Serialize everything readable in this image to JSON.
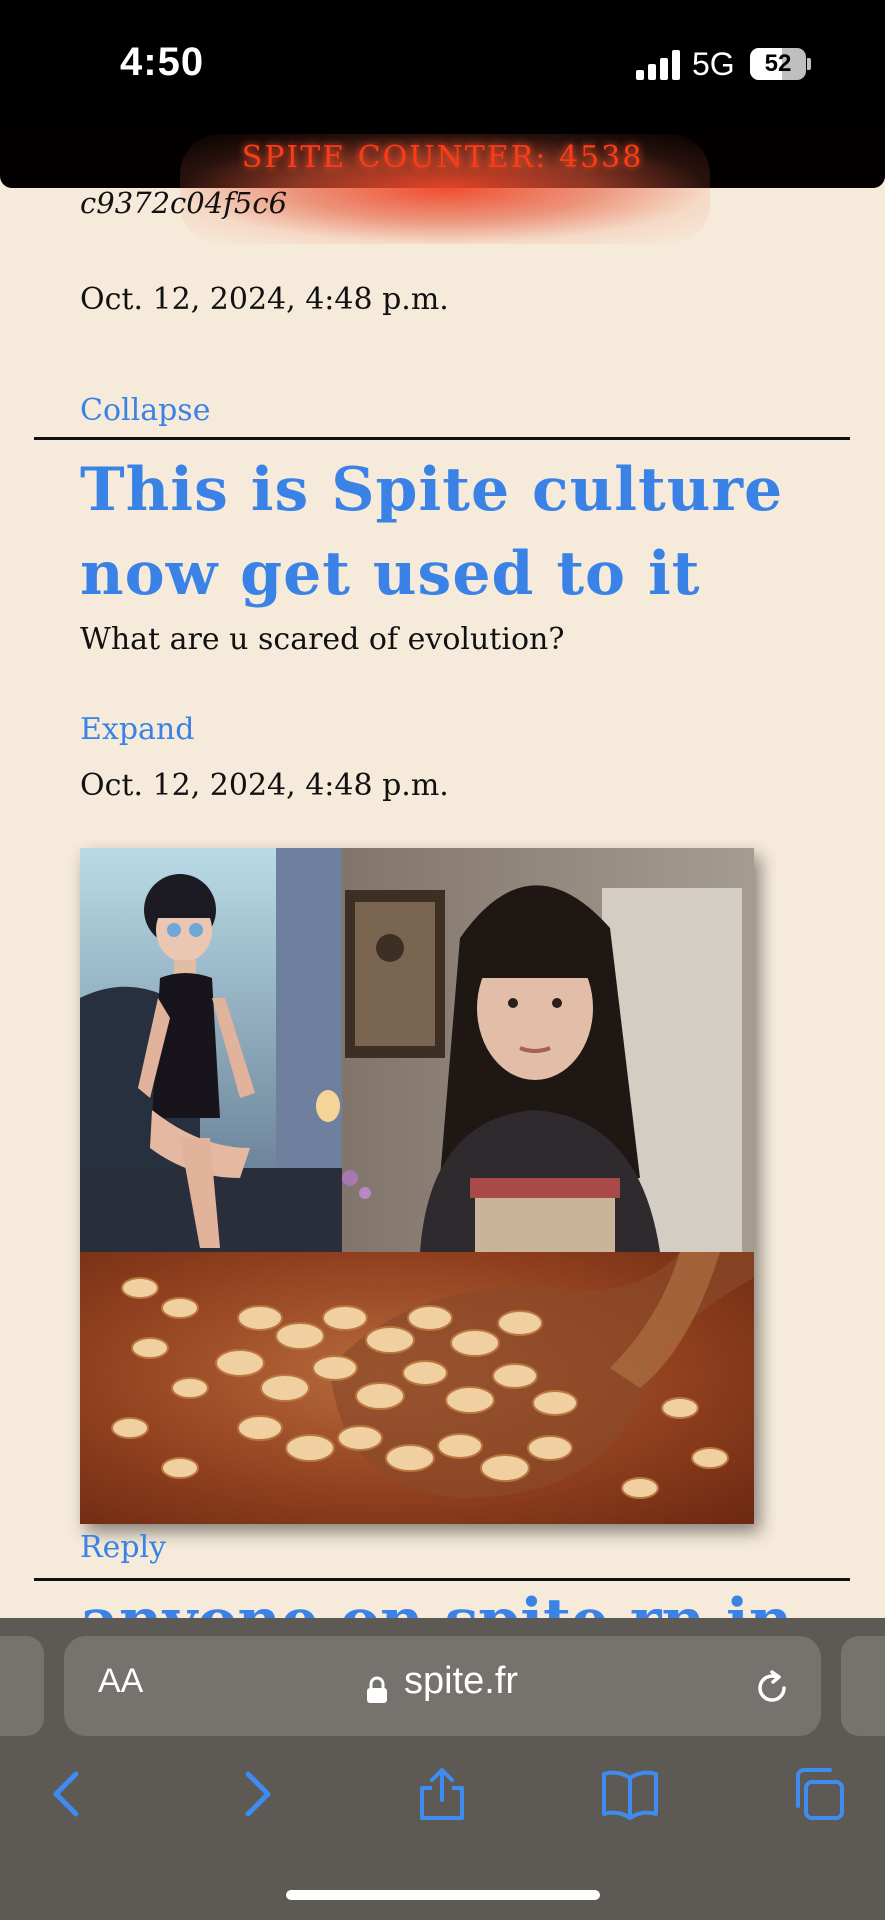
{
  "status_bar": {
    "time": "4:50",
    "network": "5G",
    "battery": "52",
    "battery_level": 0.52
  },
  "spite_counter": "SPITE COUNTER: 4538",
  "previous_post": {
    "author": "c9372c04f5c6",
    "date": "Oct. 12, 2024, 4:48 p.m.",
    "collapse_label": "Collapse"
  },
  "post": {
    "title": "This is Spite culture now get used to it",
    "body": "What are u scared of evolution?",
    "expand_label": "Expand",
    "date": "Oct. 12, 2024, 4:48 p.m.",
    "reply_label": "Reply"
  },
  "next_post": {
    "title_partial": "anyone on spite rn in"
  },
  "browser": {
    "aa_label": "AA",
    "url": "spite.fr",
    "icons": {
      "back": "chevron-left-icon",
      "forward": "chevron-right-icon",
      "share": "share-icon",
      "bookmarks": "book-icon",
      "tabs": "tabs-icon",
      "lock": "lock-icon",
      "reload": "reload-icon"
    }
  },
  "colors": {
    "page_bg": "#f6ebda",
    "link": "#3b82e6",
    "counter": "#ff3a1a",
    "browser_bar": "#5d5a55"
  }
}
